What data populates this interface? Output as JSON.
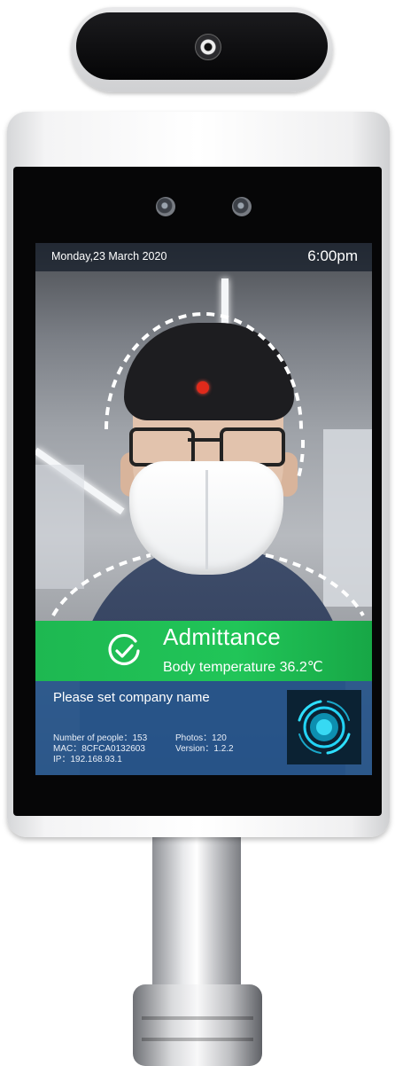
{
  "screen": {
    "date": "Monday,23 March 2020",
    "time": "6:00pm",
    "status": {
      "title": "Admittance",
      "temperature_text": "Body temperature 36.2℃",
      "color": "#21c558"
    },
    "company": "Please set company name",
    "info": {
      "people_count": "Number of people：153",
      "photos": "Photos：120",
      "mac": "MAC：8CFCA0132603",
      "version": "Version：1.2.2",
      "ip": "IP：192.168.93.1"
    },
    "panel_color": "#27568c",
    "target_dot_color": "#e02a1b",
    "icons": [
      "check-circle-icon",
      "face-scan-logo-icon",
      "target-dot-icon"
    ]
  }
}
